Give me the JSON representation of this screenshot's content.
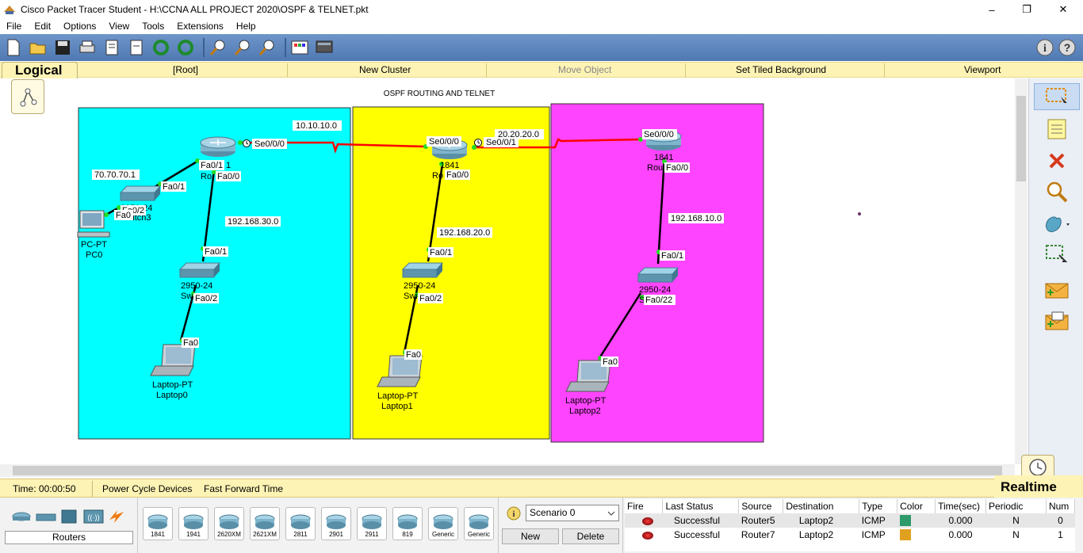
{
  "window": {
    "title": "Cisco Packet Tracer Student - H:\\CCNA ALL PROJECT 2020\\OSPF & TELNET.pkt",
    "minimize": "–",
    "maximize": "❐",
    "close": "✕"
  },
  "menu": [
    "File",
    "Edit",
    "Options",
    "View",
    "Tools",
    "Extensions",
    "Help"
  ],
  "workspace_bar": {
    "tab": "Logical",
    "root": "[Root]",
    "new_cluster": "New Cluster",
    "move_object": "Move Object",
    "set_tiled_background": "Set Tiled Background",
    "viewport": "Viewport"
  },
  "canvas": {
    "title": "OSPF ROUTING AND TELNET",
    "zones": [
      {
        "name": "cyan-area",
        "color": "#00ffff"
      },
      {
        "name": "yellow-area",
        "color": "#ffff00"
      },
      {
        "name": "magenta-area",
        "color": "#ff44ff"
      }
    ],
    "network_labels": [
      "10.10.10.0",
      "20.20.20.0",
      "70.70.70.1",
      "192.168.30.0",
      "192.168.20.0",
      "192.168.10.0"
    ],
    "port_labels": {
      "r0_se": "Se0/0/0",
      "r0_fa1": "Fa0/1",
      "r0_fa0": "Fa0/0",
      "r1_se0": "Se0/0/0",
      "r1_se1": "Se0/0/1",
      "r1_fa0": "Fa0/0",
      "r2_se0": "Se0/0/0",
      "r2_fa0": "Fa0/0",
      "sw3_fa1": "Fa0/1",
      "sw3_fa2": "Fa0/2",
      "pc0_fa0": "Fa0",
      "sw0_fa1": "Fa0/1",
      "sw0_fa2": "Fa0/2",
      "lap0_fa0": "Fa0",
      "sw1_fa1": "Fa0/1",
      "sw1_fa2": "Fa0/2",
      "lap1_fa0": "Fa0",
      "sw2_fa1": "Fa0/1",
      "sw2_fa22": "Fa0/22",
      "lap2_fa0": "Fa0"
    },
    "devices": {
      "router0": {
        "model": "1",
        "name": "Ro"
      },
      "router1": {
        "model": "1841",
        "name": "Ro"
      },
      "router2": {
        "model": "1841",
        "name": "Rou"
      },
      "switch3": {
        "model": "2950-24",
        "name": "Switch3"
      },
      "pc0": {
        "model": "PC-PT",
        "name": "PC0"
      },
      "switch0": {
        "model": "2950-24",
        "name": "Swi"
      },
      "switch1": {
        "model": "2950-24",
        "name": "Swi"
      },
      "switch2": {
        "model": "2950-24",
        "name": "S"
      },
      "laptop0": {
        "model": "Laptop-PT",
        "name": "Laptop0"
      },
      "laptop1": {
        "model": "Laptop-PT",
        "name": "Laptop1"
      },
      "laptop2": {
        "model": "Laptop-PT",
        "name": "Laptop2"
      }
    },
    "link_colors": {
      "serial": "#ff0000",
      "ethernet": "#000000",
      "port_up": "#22dd22"
    }
  },
  "timebar": {
    "time": "Time: 00:00:50",
    "power_cycle": "Power Cycle Devices",
    "fast_forward": "Fast Forward Time",
    "mode": "Realtime"
  },
  "device_panel": {
    "category": "Routers",
    "models": [
      "1841",
      "1941",
      "2620XM",
      "2621XM",
      "2811",
      "2901",
      "2911",
      "819",
      "Generic",
      "Generic"
    ]
  },
  "scenario": {
    "selected": "Scenario 0",
    "new_label": "New",
    "delete_label": "Delete"
  },
  "pdu_table": {
    "headers": [
      "Fire",
      "Last Status",
      "Source",
      "Destination",
      "Type",
      "Color",
      "Time(sec)",
      "Periodic",
      "Num"
    ],
    "rows": [
      {
        "status": "Successful",
        "source": "Router5",
        "destination": "Laptop2",
        "type": "ICMP",
        "color": "#2e9a6a",
        "time": "0.000",
        "periodic": "N",
        "num": "0"
      },
      {
        "status": "Successful",
        "source": "Router7",
        "destination": "Laptop2",
        "type": "ICMP",
        "color": "#e0a020",
        "time": "0.000",
        "periodic": "N",
        "num": "1"
      }
    ]
  }
}
